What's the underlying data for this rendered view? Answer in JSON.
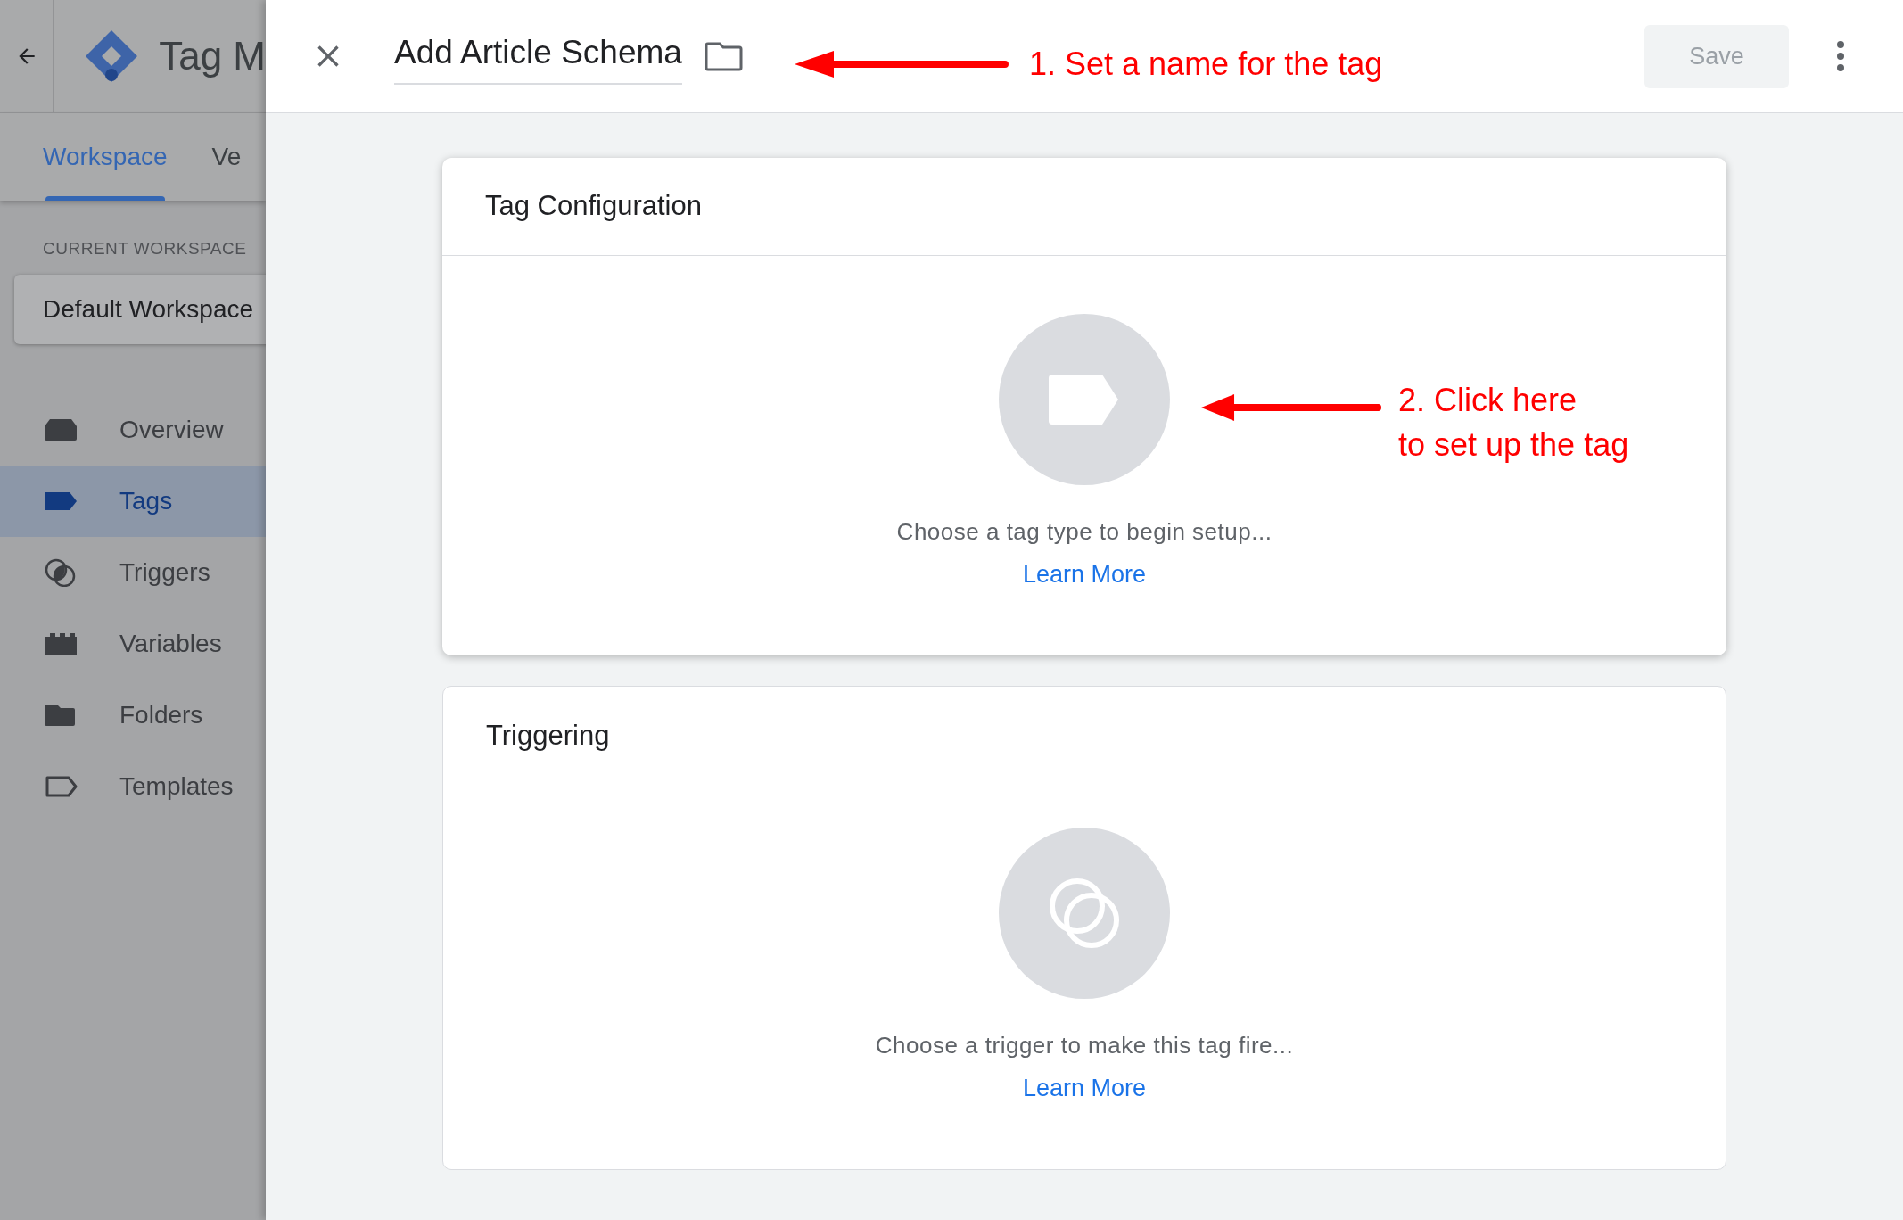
{
  "app": {
    "title": "Tag M",
    "tabs": [
      {
        "label": "Workspace",
        "selected": true
      },
      {
        "label": "Ve",
        "selected": false
      }
    ],
    "workspace_label": "CURRENT WORKSPACE",
    "workspace": "Default Workspace",
    "nav": [
      {
        "label": "Overview",
        "kind": "overview",
        "selected": false
      },
      {
        "label": "Tags",
        "kind": "tag",
        "selected": true
      },
      {
        "label": "Triggers",
        "kind": "trigger",
        "selected": false
      },
      {
        "label": "Variables",
        "kind": "variable",
        "selected": false
      },
      {
        "label": "Folders",
        "kind": "folder",
        "selected": false
      },
      {
        "label": "Templates",
        "kind": "template",
        "selected": false
      }
    ]
  },
  "editor": {
    "tag_name": "Add Article Schema",
    "save": {
      "label": "Save",
      "disabled": true
    },
    "cards": [
      {
        "title": "Tag Configuration",
        "kind": "tag",
        "hint": "Choose a tag type to begin setup...",
        "link": "Learn More"
      },
      {
        "title": "Triggering",
        "kind": "trigger",
        "hint": "Choose a trigger to make this tag fire...",
        "link": "Learn More"
      }
    ]
  },
  "annotations": [
    {
      "lines": [
        "1. Set a name for the tag"
      ]
    },
    {
      "lines": [
        "2. Click here",
        "to set up the tag"
      ]
    }
  ]
}
